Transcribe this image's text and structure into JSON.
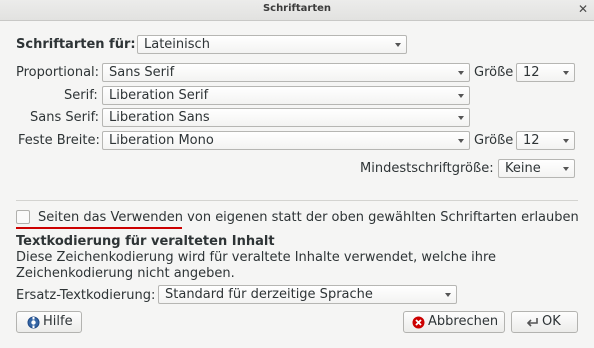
{
  "window": {
    "title": "Schriftarten"
  },
  "language": {
    "label": "Schriftarten für:",
    "value": "Lateinisch"
  },
  "proportional": {
    "label": "Proportional:",
    "value": "Sans Serif",
    "size_label": "Größe",
    "size": "12"
  },
  "serif": {
    "label": "Serif:",
    "value": "Liberation Serif"
  },
  "sans_serif": {
    "label": "Sans Serif:",
    "value": "Liberation Sans"
  },
  "monospace": {
    "label": "Feste Breite:",
    "value": "Liberation Mono",
    "size_label": "Größe",
    "size": "12"
  },
  "min_size": {
    "label": "Mindestschriftgröße:",
    "value": "Keine"
  },
  "allow_fonts": {
    "label": "Seiten das Verwenden von eigenen statt der oben gewählten Schriftarten erlauben",
    "checked": false
  },
  "encoding": {
    "heading": "Textkodierung für veralteten Inhalt",
    "description_line1": "Diese Zeichenkodierung wird für veraltete Inhalte verwendet, welche ihre",
    "description_line2": "Zeichenkodierung nicht angeben.",
    "fallback_label": "Ersatz-Textkodierung:",
    "fallback_value": "Standard für derzeitige Sprache"
  },
  "buttons": {
    "help": "Hilfe",
    "cancel": "Abbrechen",
    "ok": "OK"
  },
  "colors": {
    "accent_underline": "#cc0000",
    "cancel_icon": "#cc0000",
    "help_icon": "#3465a4"
  }
}
